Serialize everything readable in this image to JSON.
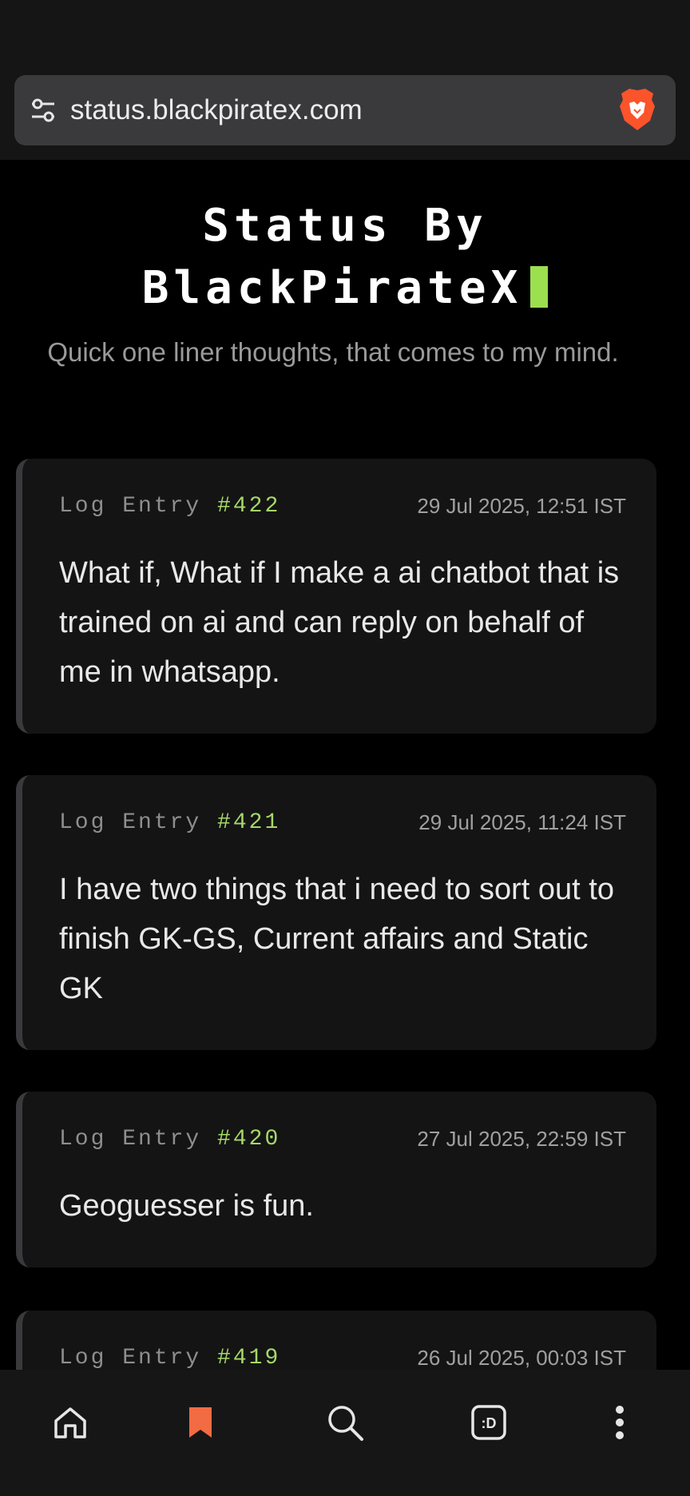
{
  "browser": {
    "url": "status.blackpiratex.com"
  },
  "page": {
    "title_line1": "Status By",
    "title_line2": "BlackPirateX",
    "subtitle": "Quick one liner thoughts, that comes to my mind."
  },
  "entries": [
    {
      "label": "Log Entry",
      "number": "#422",
      "date": "29 Jul 2025, 12:51 IST",
      "text": "What if, What if I make a ai chatbot that is trained on ai and can reply on behalf of me in whatsapp."
    },
    {
      "label": "Log Entry",
      "number": "#421",
      "date": "29 Jul 2025, 11:24 IST",
      "text": "I have two things that i need to sort out to finish GK-GS, Current affairs and Static GK"
    },
    {
      "label": "Log Entry",
      "number": "#420",
      "date": "27 Jul 2025, 22:59 IST",
      "text": "Geoguesser is fun."
    },
    {
      "label": "Log Entry",
      "number": "#419",
      "date": "26 Jul 2025, 00:03 IST",
      "text": ""
    }
  ],
  "nav": {
    "items": [
      {
        "icon": "home-icon"
      },
      {
        "icon": "bookmark-icon"
      },
      {
        "icon": "search-icon"
      },
      {
        "icon": "tab-switcher-icon",
        "label": ":D"
      },
      {
        "icon": "more-vertical-icon"
      }
    ]
  },
  "colors": {
    "accent_green": "#9cdf4f",
    "bookmark_orange": "#f26b42",
    "brave_orange": "#fb542b"
  }
}
